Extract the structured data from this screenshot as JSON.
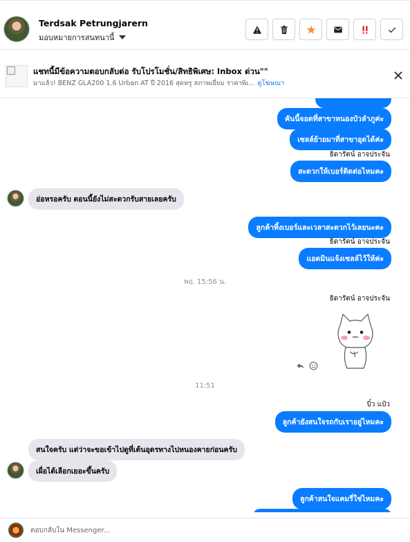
{
  "header": {
    "contact_name": "Terdsak Petrungjarern",
    "assign_label": "มอบหมายการสนทนานี้",
    "actions": [
      {
        "name": "report-button",
        "icon": "warning-icon"
      },
      {
        "name": "delete-button",
        "icon": "trash-icon"
      },
      {
        "name": "star-button",
        "icon": "star-icon"
      },
      {
        "name": "mark-unread-button",
        "icon": "envelope-icon"
      },
      {
        "name": "mark-important-button",
        "icon": "double-exclamation-icon"
      },
      {
        "name": "mark-done-button",
        "icon": "check-icon"
      }
    ]
  },
  "notice": {
    "title": "แชทนี้มีข้อความตอบกลับต่อ รับโปรโมชั่น/สิทธิพิเศษ: Inbox ด่วน\"\"",
    "desc": "มาแล้ว! BENZ GLA200 1.6 Urban AT ปี 2016 สุดหรู สภาพเยี่ยม ราคาพิเ...",
    "link": "ดูโฆษณา"
  },
  "messages": {
    "m1": "คันนี้จอดที่สาขาหนองบัวลำภูค่ะ",
    "m2": "เซลล์ย้ายมาที่สาขาอุดได้ค่ะ",
    "sender1": "ธิดารัตน์ อาจประจัน",
    "m3": "สะดวกให้เบอร์ติดต่อไหมคะ",
    "in1": "อ่อหรอครับ ตอนนี้ยังไม่สะดวกรับสายเลยครับ",
    "m4": "ลูกค้าทิ้งเบอร์และเวลาสะดวกไว้เลยนะคะ",
    "sender2": "ธิดารัตน์ อาจประจัน",
    "m5": "แอดมินแจ้งเซลล์ไว้ให้ค่ะ",
    "time1": "พฤ. 15:56 น.",
    "sender3": "ธิดารัตน์ อาจประจัน",
    "time2": "11:51",
    "sender4": "บิ๋ว แป๋ว",
    "m6": "ลูกค้ายังสนใจรถกับเราอยู่ไหมคะ",
    "in2": "สนใจครับ แต่ว่าจะขอเข้าไปดูที่เต้นอุดรทางไปหนองคายก่อนครับ",
    "in3": "เผื่อได้เลือกเยอะขึ้นครับ",
    "m7": "ลูกค้าสนใจแคมรี่ใช่ไหมคะ"
  },
  "composer": {
    "placeholder": "ตอบกลับใน Messenger..."
  },
  "colors": {
    "outgoing_bubble": "#0a7cff",
    "incoming_bubble": "#e4e6eb",
    "link": "#1877f2",
    "star": "#f7923b",
    "important": "#e02020"
  }
}
